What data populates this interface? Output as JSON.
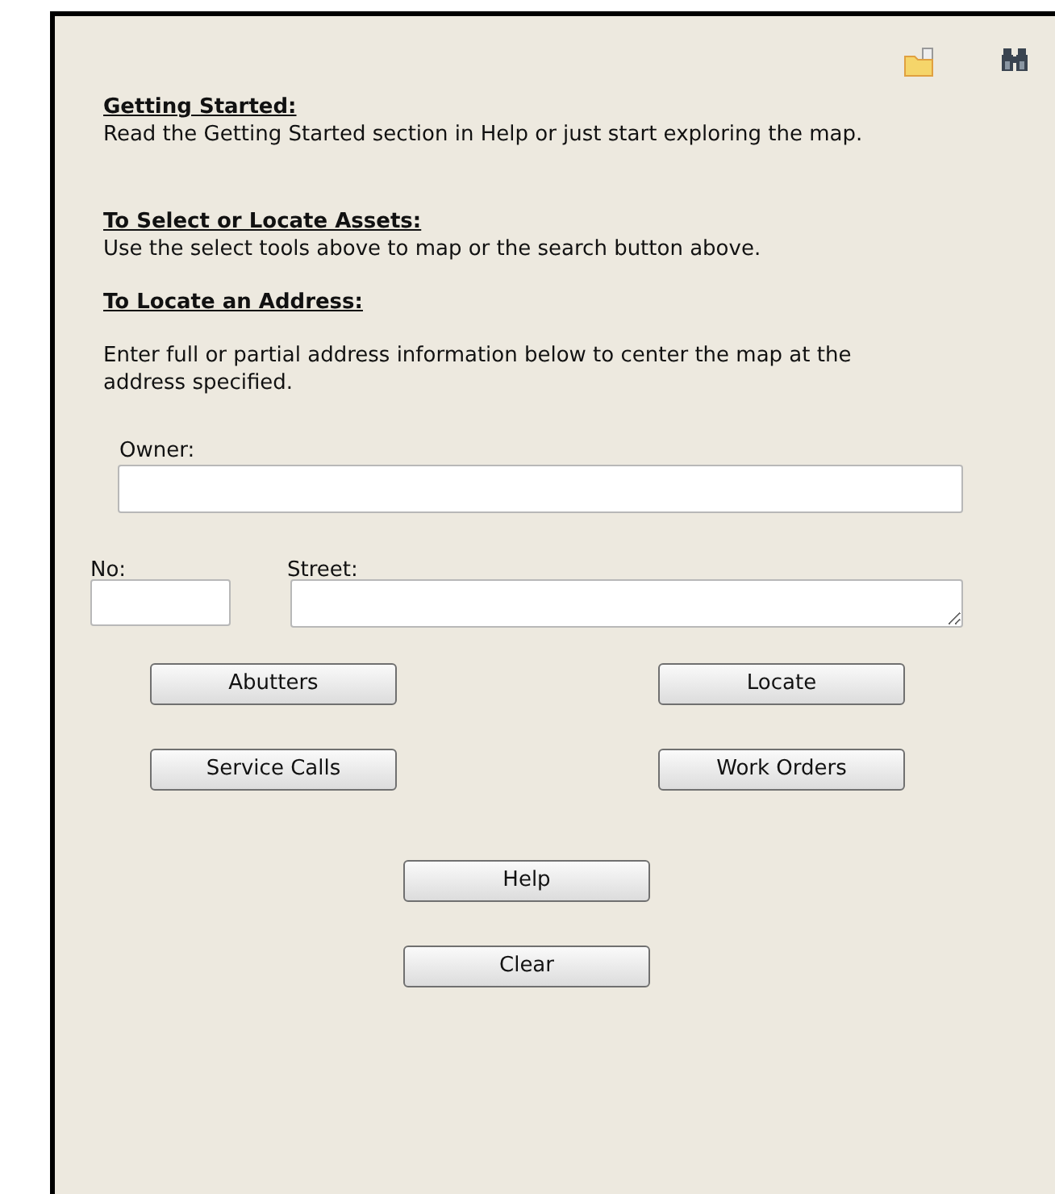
{
  "toolbar": {
    "icons": [
      {
        "kind": "folder"
      },
      {
        "kind": "binoculars"
      }
    ]
  },
  "sections": [
    {
      "heading": "Getting Started:",
      "text": "Read the Getting Started section in Help or just start exploring the map."
    },
    {
      "heading": "To Select or Locate Assets:",
      "text": "Use the select tools above to map or the search button above."
    },
    {
      "heading": "To Locate an Address:",
      "text": "Enter full or partial address information below to center the map at the address specified."
    }
  ],
  "fields": {
    "owner": {
      "label": "Owner:"
    },
    "number": {
      "label": "No:"
    },
    "street": {
      "label": "Street:"
    }
  },
  "buttons": [
    [
      "Abutters",
      "Locate"
    ],
    [
      "Service Calls",
      "Work Orders"
    ],
    [
      "Help"
    ],
    [
      "Clear"
    ]
  ]
}
